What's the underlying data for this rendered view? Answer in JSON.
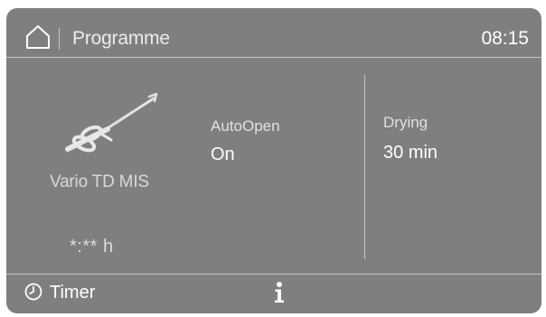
{
  "header": {
    "home_icon": "home-icon",
    "title": "Programme",
    "time": "08:15"
  },
  "program": {
    "icon": "surgical-instrument-icon",
    "name": "Vario TD MIS",
    "remaining_time": "*:** h"
  },
  "options": {
    "autoopen": {
      "label": "AutoOpen",
      "value": "On"
    },
    "drying": {
      "label": "Drying",
      "value": "30 min"
    }
  },
  "footer": {
    "timer_icon": "clock-icon",
    "timer_label": "Timer",
    "info_icon": "info-icon"
  },
  "colors": {
    "screen_background": "#7f7f7f",
    "text_primary": "#ffffff",
    "text_secondary": "#d8d8d8",
    "divider": "#c6c6c6"
  }
}
